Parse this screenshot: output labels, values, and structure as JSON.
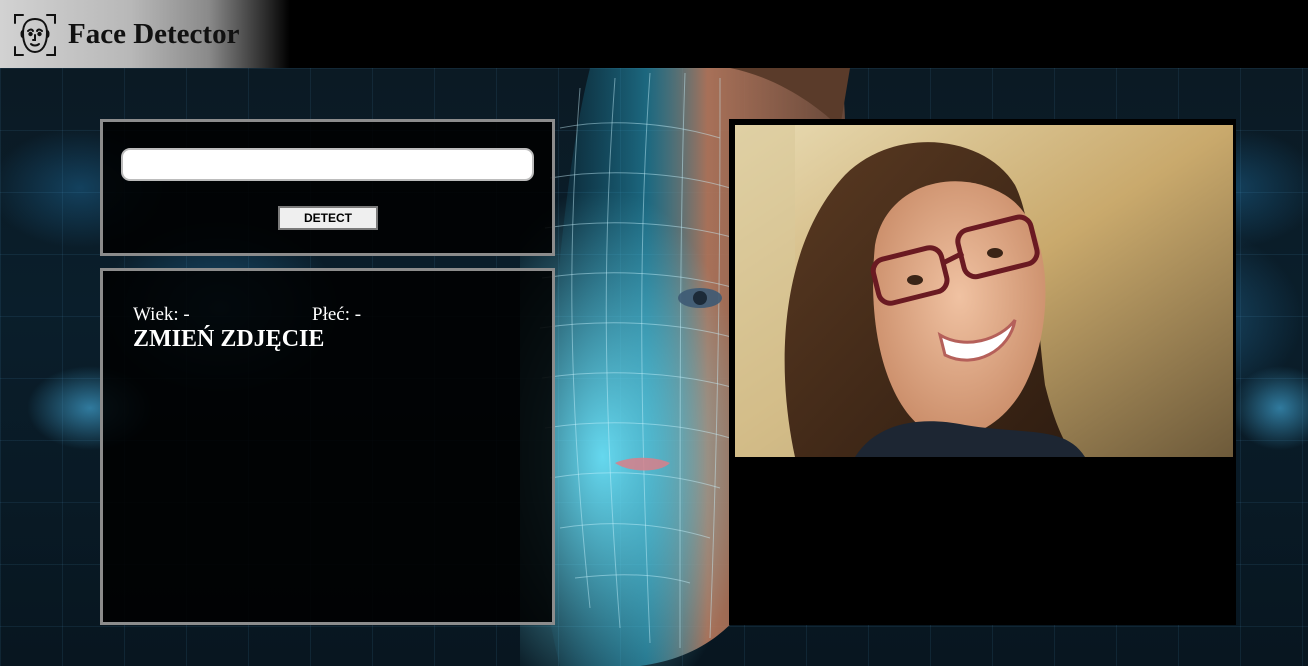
{
  "header": {
    "title": "Face Detector",
    "icon": "face-scan-icon"
  },
  "form": {
    "url_value": "",
    "url_placeholder": "",
    "detect_label": "DETECT"
  },
  "results": {
    "age_label": "Wiek:",
    "age_value": "-",
    "gender_label": "Płeć:",
    "gender_value": "-",
    "change_photo_label": "ZMIEŃ ZDJĘCIE"
  },
  "colors": {
    "header_bg": "#000000",
    "brand_gradient_start": "#d2d2d2",
    "panel_border": "#8c8c8c",
    "panel_bg": "#000000",
    "text": "#ffffff"
  }
}
